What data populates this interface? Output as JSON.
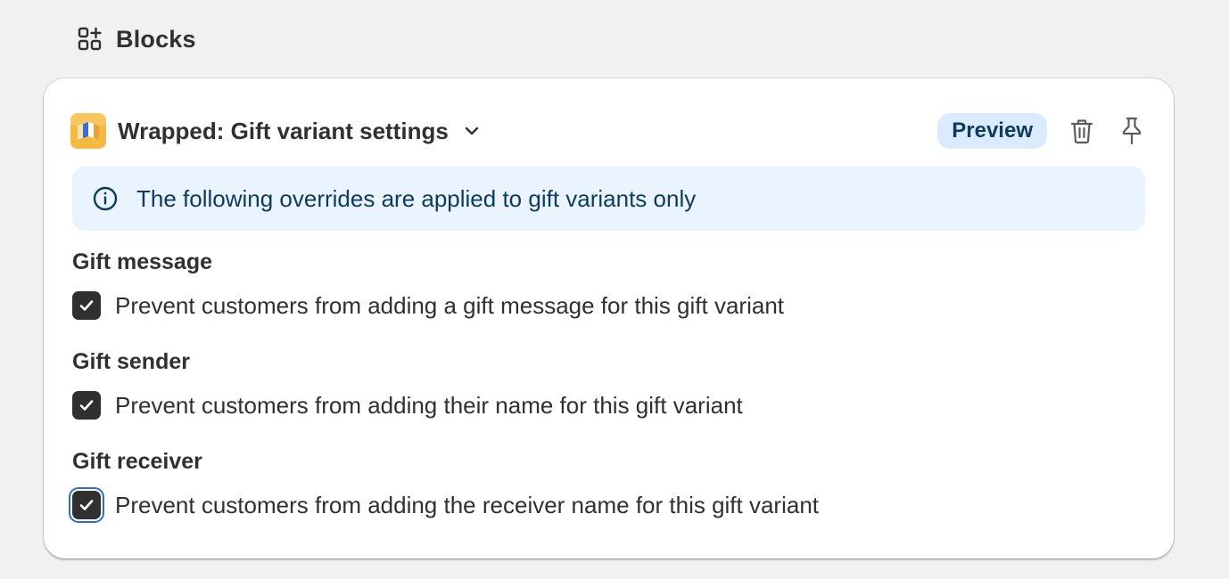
{
  "section": {
    "title": "Blocks",
    "icon": "blocks-add-icon"
  },
  "block": {
    "title": "Wrapped: Gift variant settings",
    "preview_label": "Preview",
    "logo": "wrapped-app-logo"
  },
  "banner": {
    "text": "The following overrides are applied to gift variants only"
  },
  "groups": [
    {
      "label": "Gift message",
      "option": "Prevent customers from adding a gift message for this gift variant",
      "checked": true
    },
    {
      "label": "Gift sender",
      "option": "Prevent customers from adding their name for this gift variant",
      "checked": true
    },
    {
      "label": "Gift receiver",
      "option": "Prevent customers from adding the receiver name for this gift variant",
      "checked": true
    }
  ],
  "colors": {
    "banner_bg": "#eaf4ff",
    "preview_bg": "#d9ebfc",
    "focus_ring": "#2c6ecb",
    "checkbox": "#303030"
  }
}
